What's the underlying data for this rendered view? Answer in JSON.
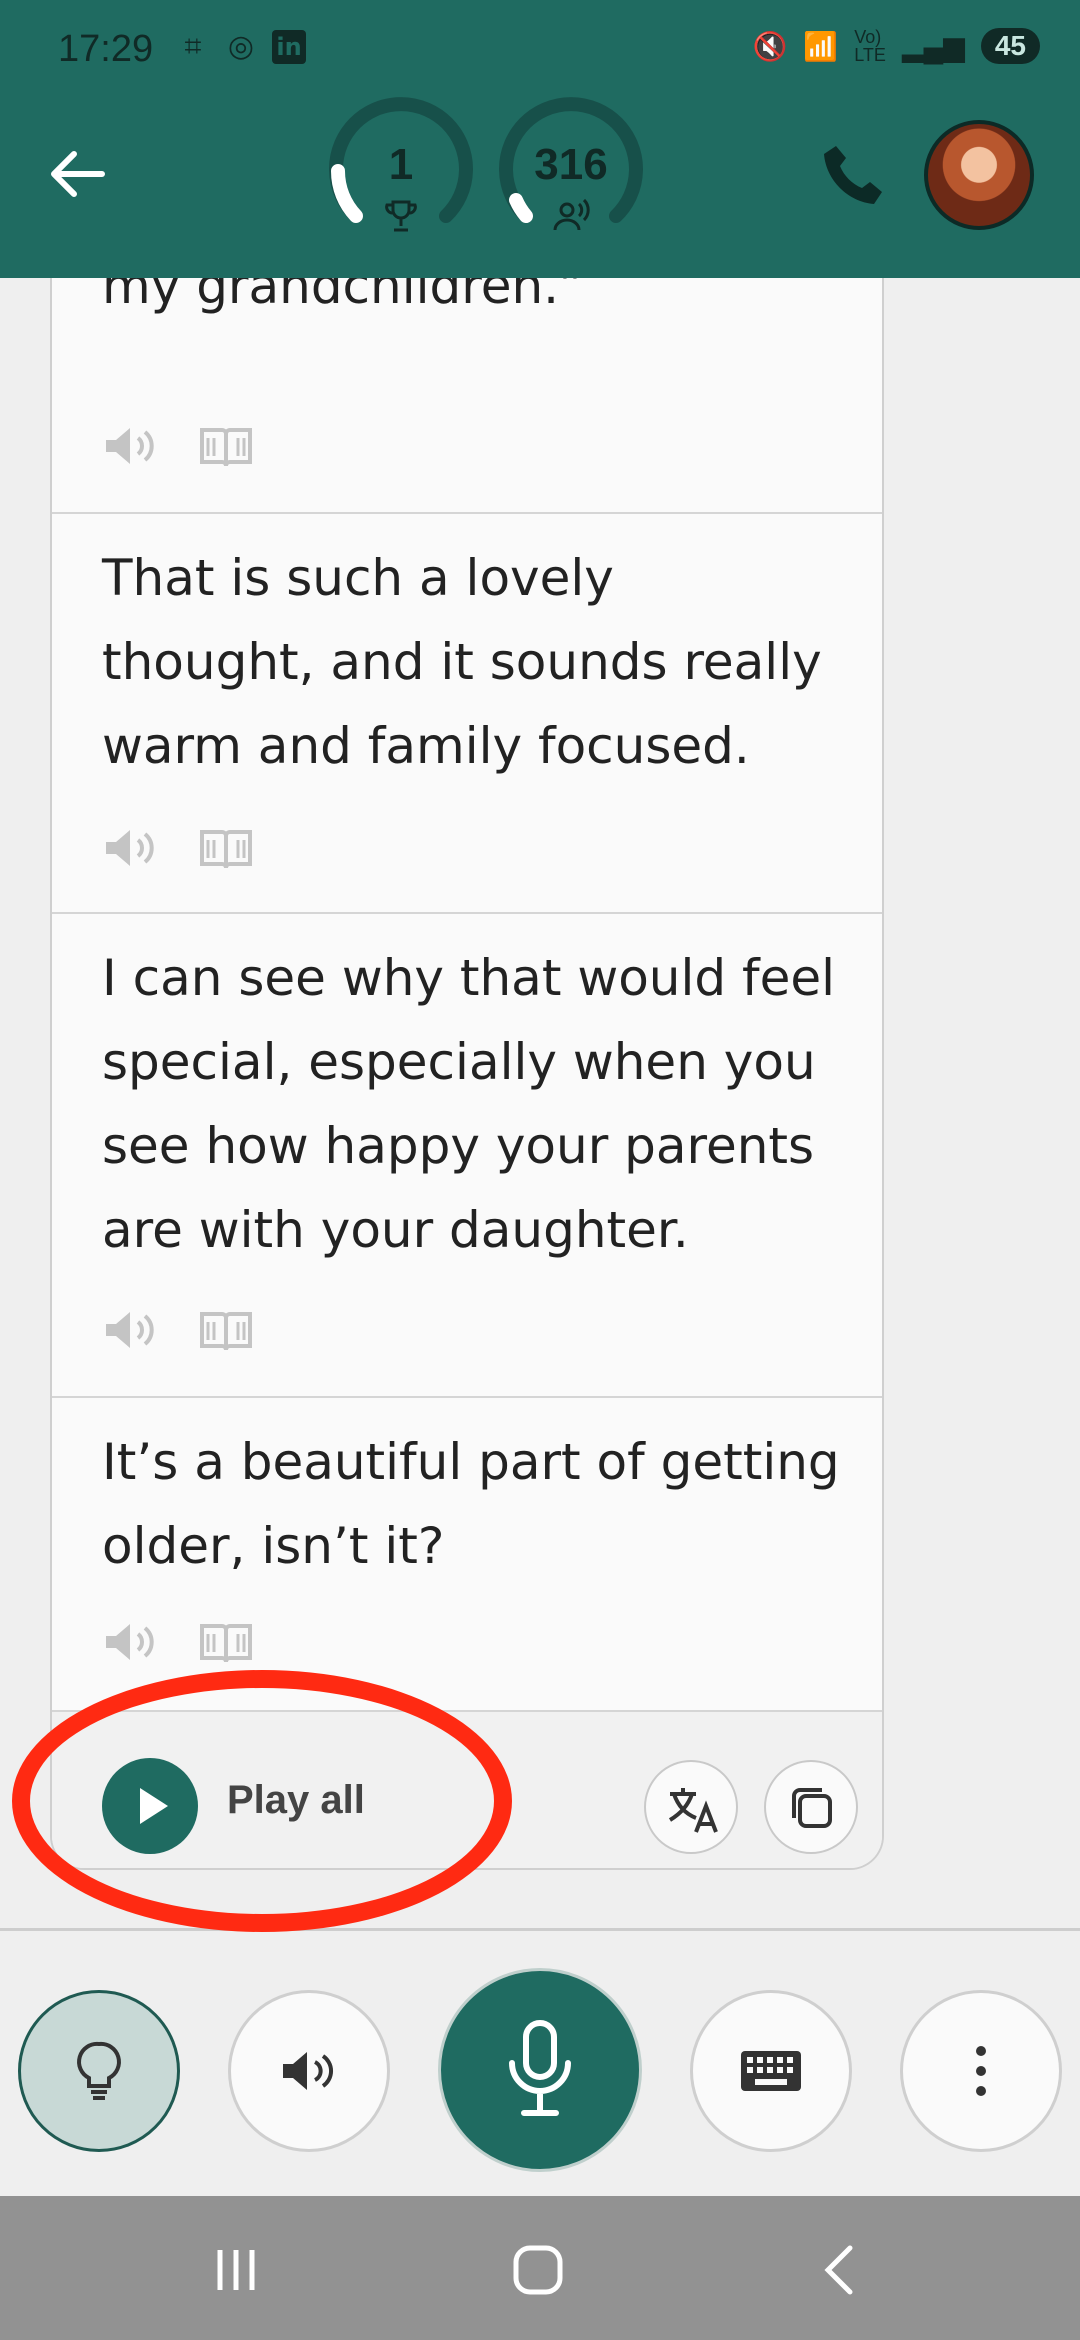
{
  "status_bar": {
    "time": "17:29",
    "battery": "45"
  },
  "header": {
    "score_trophy": "1",
    "score_listeners": "316"
  },
  "messages": [
    {
      "text": "spending a lot of time with my grandchildren.”"
    },
    {
      "text": "That is such a lovely thought, and it sounds really warm and family focused."
    },
    {
      "text": "I can see why that would feel special, especially when you see how happy your parents are with your daughter."
    },
    {
      "text": "It’s a beautiful part of getting older, isn’t it?"
    }
  ],
  "footer": {
    "play_all_label": "Play all"
  },
  "toolbar": [
    "hint",
    "speaker",
    "microphone",
    "keyboard",
    "more"
  ],
  "colors": {
    "primary": "#1f6b61",
    "highlight": "#ff2a12"
  }
}
